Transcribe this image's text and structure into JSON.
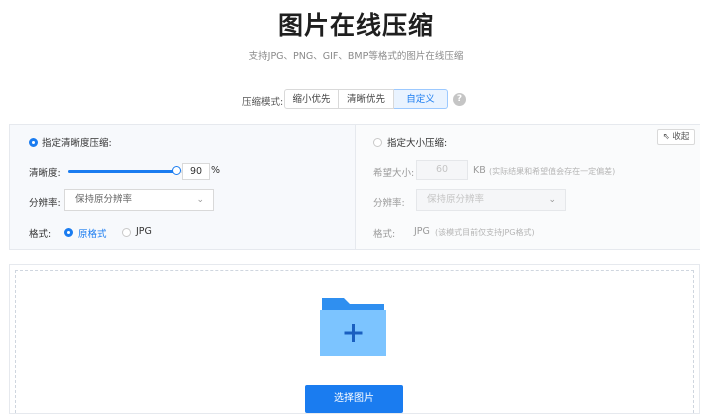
{
  "header": {
    "title": "图片在线压缩",
    "subtitle": "支持JPG、PNG、GIF、BMP等格式的图片在线压缩"
  },
  "mode": {
    "label": "压缩模式:",
    "options": [
      "缩小优先",
      "清晰优先",
      "自定义"
    ],
    "selected": "自定义",
    "help": "?"
  },
  "left": {
    "option_label": "指定清晰度压缩:",
    "quality_label": "清晰度:",
    "quality_value": "90",
    "quality_percent": 0.9,
    "unit": "%",
    "resolution_label": "分辨率:",
    "resolution_value": "保持原分辨率",
    "format_label": "格式:",
    "format_original": "原格式",
    "format_jpg": "JPG"
  },
  "right": {
    "option_label": "指定大小压缩:",
    "size_label": "希望大小:",
    "size_value": "60",
    "size_unit": "KB",
    "size_note": "(实际结果和希望值会存在一定偏差)",
    "resolution_label": "分辨率:",
    "resolution_value": "保持原分辨率",
    "format_label": "格式:",
    "format_value": "JPG",
    "format_note": "(该模式目前仅支持JPG格式)",
    "collapse_label": "收起"
  },
  "upload": {
    "button_label": "选择图片"
  },
  "colors": {
    "accent": "#1a7cf0",
    "folder_back": "#2f8ff0",
    "folder_front": "#7cc4ff"
  }
}
